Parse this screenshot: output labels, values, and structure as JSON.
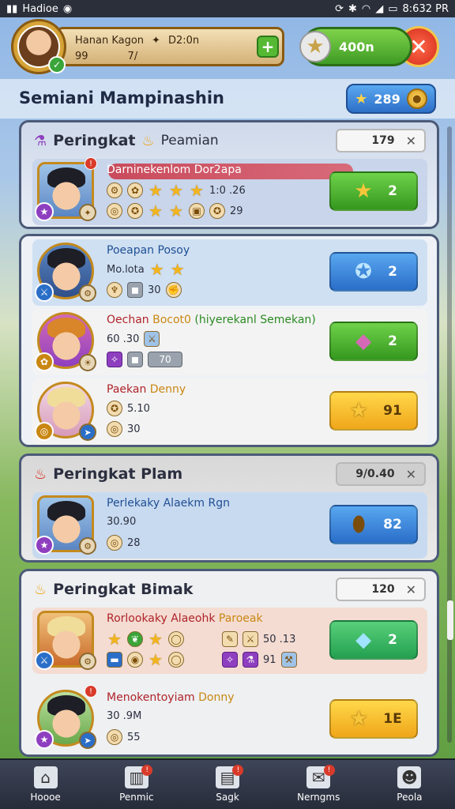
{
  "status_bar": {
    "carrier": "Hadioe",
    "time": "8:632 PR"
  },
  "header": {
    "player_name": "Hanan Kagon",
    "player_points": "D2:0n",
    "player_level": "99",
    "player_sub": "7/",
    "currency_value": "400n"
  },
  "page": {
    "title": "Semiani Mampinashin",
    "score": "289"
  },
  "sections": [
    {
      "header": "Peringkat",
      "header_extra": "Peamian",
      "count": "179",
      "rows": [
        {
          "name": "Darninekenlom",
          "tag": "Dor2apa",
          "stat1": "1:0 .26",
          "stat2": "29",
          "action_value": "2"
        }
      ]
    },
    {
      "header": "",
      "rows": [
        {
          "name": "Poeapan",
          "tag": "Posoy",
          "stat1": "Mo.lota",
          "stat2": "30",
          "action_value": "2"
        },
        {
          "name": "Oechan",
          "tag": "Bocot0",
          "tag2": "(hiyerekanl Semekan)",
          "stat1": "60 .30",
          "stat2": "70",
          "action_value": "2"
        },
        {
          "name": "Paekan",
          "tag": "Denny",
          "stat1": "5.10",
          "stat2": "30",
          "action_value": "91"
        }
      ]
    },
    {
      "header": "Peringkat Plam",
      "count": "9/0.40",
      "rows": [
        {
          "name": "Perlekaky Alaekm",
          "tag": "Rgn",
          "stat1": "30.90",
          "stat2": "28",
          "action_value": "82"
        }
      ]
    },
    {
      "header": "Peringkat Bimak",
      "count": "120",
      "rows": [
        {
          "name": "Rorlookaky Alaeohk",
          "tag": "Paroeak",
          "stat1": "50 .13",
          "stat2": "91",
          "action_value": "2"
        },
        {
          "name": "Menokentoyiam",
          "tag": "Donny",
          "stat1": "30 .9M",
          "stat2": "55",
          "action_value": "1E"
        }
      ]
    }
  ],
  "bottom_nav": [
    {
      "label": "Hoooe",
      "icon": "home-icon"
    },
    {
      "label": "Penmic",
      "icon": "ranking-icon"
    },
    {
      "label": "Sagk",
      "icon": "shop-icon"
    },
    {
      "label": "Nerngms",
      "icon": "messages-icon"
    },
    {
      "label": "Peola",
      "icon": "profile-icon"
    }
  ],
  "colors": {
    "accent_green": "#3f9b25",
    "accent_blue": "#2a6ec8",
    "accent_yellow": "#f0a61a",
    "close_red": "#d42a1a"
  }
}
